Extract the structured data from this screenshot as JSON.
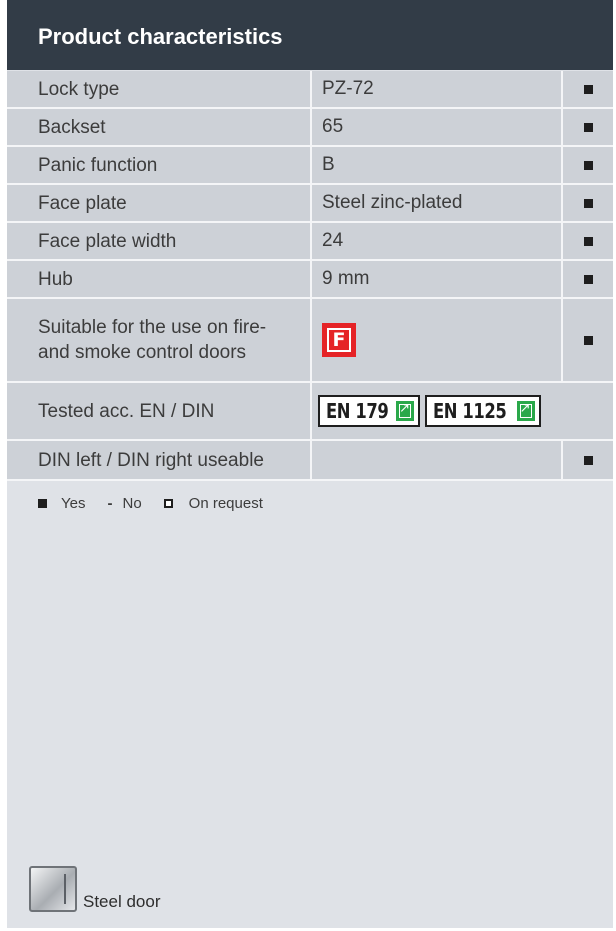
{
  "header": {
    "title": "Product characteristics"
  },
  "rows": [
    {
      "label": "Lock type",
      "value": "PZ-72",
      "mark": "yes"
    },
    {
      "label": "Backset",
      "value": "65",
      "mark": "yes"
    },
    {
      "label": "Panic function",
      "value": "B",
      "mark": "yes"
    },
    {
      "label": "Face plate",
      "value": "Steel zinc-plated",
      "mark": "yes"
    },
    {
      "label": "Face plate width",
      "value": "24",
      "mark": "yes"
    },
    {
      "label": "Hub",
      "value": "9 mm",
      "mark": "yes"
    }
  ],
  "fire_row": {
    "label": "Suitable for the use on fire- and smoke control doors",
    "badge_text": "F",
    "badge_color": "#e52326",
    "mark": "yes"
  },
  "tested_row": {
    "label": "Tested acc. EN / DIN",
    "badges": [
      "EN 179",
      "EN 1125"
    ],
    "badge_icon": "emergency-exit-icon",
    "badge_icon_color": "#2aa84a"
  },
  "din_row": {
    "label": "DIN left / DIN right useable",
    "value": "",
    "mark": "yes"
  },
  "legend": {
    "yes": "Yes",
    "no_symbol": "-",
    "no": "No",
    "on_request": "On request"
  },
  "footer": {
    "door_label": "Steel door",
    "door_icon": "steel-door-icon"
  },
  "colors": {
    "header_bg": "#323c47",
    "panel_bg": "#dfe2e7",
    "row_bg": "#cdd1d7"
  }
}
